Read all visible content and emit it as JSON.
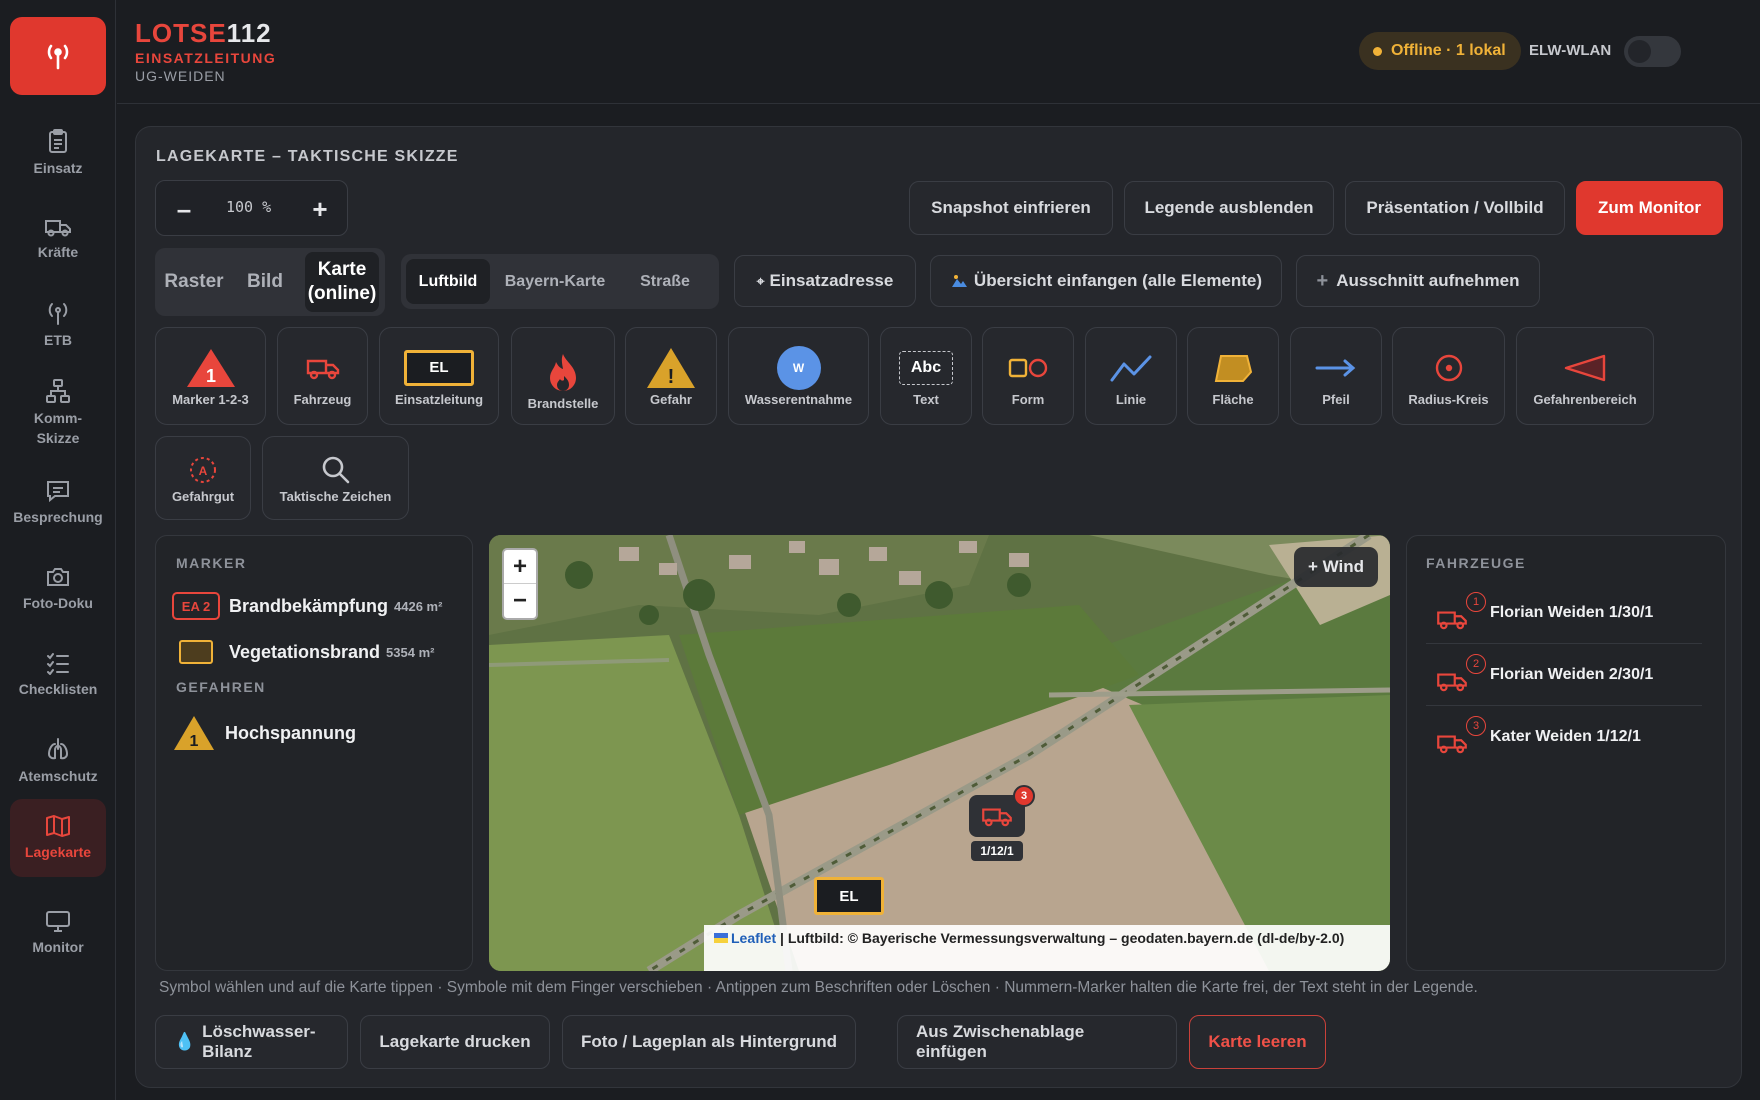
{
  "brand": {
    "name_red": "LOTSE",
    "name_white": "112",
    "subtitle": "EINSATZLEITUNG",
    "unit": "UG-WEIDEN"
  },
  "sidebar": {
    "items": [
      {
        "label": "Einsatz"
      },
      {
        "label": "Kräfte"
      },
      {
        "label": "ETB"
      },
      {
        "label_line1": "Komm-",
        "label_line2": "Skizze"
      },
      {
        "label": "Besprechung"
      },
      {
        "label": "Foto-Doku"
      },
      {
        "label": "Checklisten"
      },
      {
        "label": "Atemschutz"
      },
      {
        "label": "Lagekarte"
      },
      {
        "label": "Monitor"
      }
    ],
    "active": "Lagekarte"
  },
  "header": {
    "status": "Offline · 1 lokal",
    "wlan_label": "ELW-WLAN",
    "wlan_on": false
  },
  "panel": {
    "title": "LAGEKARTE – TAKTISCHE SKIZZE",
    "zoom": {
      "minus": "–",
      "value": "100 %",
      "plus": "+"
    },
    "actions": {
      "snapshot": "Snapshot einfrieren",
      "legend": "Legende ausblenden",
      "presentation": "Präsentation / Vollbild",
      "monitor": "Zum Monitor"
    },
    "bg_modes": {
      "raster": "Raster",
      "bild": "Bild",
      "karte_l1": "Karte",
      "karte_l2": "(online)",
      "selected": "Karte (online)"
    },
    "map_layers": {
      "luftbild": "Luftbild",
      "bayern": "Bayern-Karte",
      "strasse": "Straße",
      "selected": "Luftbild"
    },
    "map_actions": {
      "address": "Einsatzadresse",
      "overview": "Übersicht einfangen (alle Elemente)",
      "crop": "Ausschnitt aufnehmen"
    },
    "tools": [
      {
        "label": "Marker 1-2-3",
        "icon": "numbered-triangle-icon",
        "glyph": "1"
      },
      {
        "label": "Fahrzeug",
        "icon": "truck-icon"
      },
      {
        "label": "Einsatzleitung",
        "icon": "el-box-icon",
        "glyph": "EL"
      },
      {
        "label": "Brandstelle",
        "icon": "flame-icon"
      },
      {
        "label": "Gefahr",
        "icon": "warning-triangle-icon",
        "glyph": "!"
      },
      {
        "label": "Wasserentnahme",
        "icon": "water-circle-icon",
        "glyph": "W"
      },
      {
        "label": "Text",
        "icon": "text-box-icon",
        "glyph": "Abc"
      },
      {
        "label": "Form",
        "icon": "shapes-icon"
      },
      {
        "label": "Linie",
        "icon": "polyline-icon"
      },
      {
        "label": "Fläche",
        "icon": "polygon-icon"
      },
      {
        "label": "Pfeil",
        "icon": "arrow-icon"
      },
      {
        "label": "Radius-Kreis",
        "icon": "radius-circle-icon"
      },
      {
        "label": "Gefahrenbereich",
        "icon": "danger-sector-icon"
      },
      {
        "label": "Gefahrgut",
        "icon": "hazmat-icon",
        "glyph": "A"
      },
      {
        "label": "Taktische Zeichen",
        "icon": "magnifier-icon"
      }
    ],
    "legend": {
      "markers_title": "MARKER",
      "markers": [
        {
          "badge": "EA 2",
          "label": "Brandbekämpfung",
          "area": "4426 m²"
        },
        {
          "badge": "",
          "label": "Vegetationsbrand",
          "area": "5354 m²"
        }
      ],
      "dangers_title": "GEFAHREN",
      "dangers": [
        {
          "badge": "1",
          "label": "Hochspannung"
        }
      ]
    },
    "map": {
      "zoom_in": "+",
      "zoom_out": "−",
      "wind_button": "+ Wind",
      "vehicle_marker": {
        "label": "1/12/1",
        "count": "3"
      },
      "el_marker": "EL",
      "attribution_link": "Leaflet",
      "attribution_text": "| Luftbild: © Bayerische Vermessungsverwaltung – geodaten.bayern.de (dl-de/by-2.0)"
    },
    "vehicles": {
      "title": "FAHRZEUGE",
      "items": [
        {
          "num": "1",
          "name": "Florian Weiden 1/30/1"
        },
        {
          "num": "2",
          "name": "Florian Weiden 2/30/1"
        },
        {
          "num": "3",
          "name": "Kater Weiden 1/12/1"
        }
      ]
    },
    "hint": "Symbol wählen und auf die Karte tippen · Symbole mit dem Finger verschieben · Antippen zum Beschriften oder Löschen · Nummern-Marker halten die Karte frei, der Text steht in der Legende.",
    "bottom": {
      "water": "Löschwasser-Bilanz",
      "print": "Lagekarte drucken",
      "photo": "Foto / Lageplan als Hintergrund",
      "paste": "Aus Zwischenablage einfügen",
      "clear": "Karte leeren"
    }
  },
  "colors": {
    "accent": "#e0382e",
    "warning": "#f0b238",
    "bg": "#1b1d21",
    "panel": "#24262b"
  }
}
